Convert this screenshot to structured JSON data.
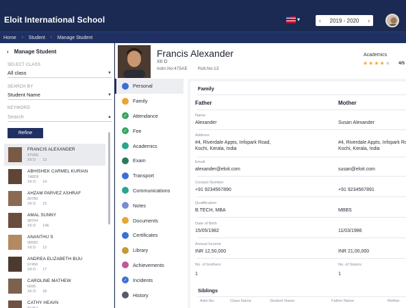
{
  "app": {
    "title": "Eloit International School",
    "year": "2019 - 2020"
  },
  "breadcrumb": [
    "Home",
    "Student",
    "Manage Student"
  ],
  "sidebar": {
    "heading": "Manage Student",
    "select_class_label": "SELECT CLASS",
    "select_class_value": "All class",
    "search_by_label": "SEARCH BY",
    "search_by_value": "Student Name",
    "keyword_label": "KEYWORD",
    "keyword_placeholder": "Search",
    "refine_label": "Refine",
    "students": [
      {
        "name": "FRANCIS ALEXANDER",
        "adm": "475AE",
        "class": "XII D",
        "roll": "13"
      },
      {
        "name": "ABHISHEK CARMEL KURIAN",
        "adm": "74BDF",
        "class": "XII D",
        "roll": "14"
      },
      {
        "name": "AHZAM PARVEZ ASHRAF",
        "adm": "89780",
        "class": "XII D",
        "roll": "15"
      },
      {
        "name": "AMAL SUNNY",
        "adm": "98764",
        "class": "XII D",
        "roll": "14E"
      },
      {
        "name": "ANANTHU S",
        "adm": "96582",
        "class": "XII D",
        "roll": "12"
      },
      {
        "name": "ANDREA ELIZABETH BIJU",
        "adm": "67456",
        "class": "XII D",
        "roll": "17"
      },
      {
        "name": "CAROLINE MATHEW",
        "adm": "6695",
        "class": "XII D",
        "roll": "18"
      },
      {
        "name": "CATHY HEAVN",
        "adm": "87454",
        "class": "XII D",
        "roll": "19"
      }
    ]
  },
  "profile": {
    "name": "Francis Alexander",
    "class": "XII D",
    "adm": "Adm.No:475AE",
    "roll": "Roll.No:13",
    "academics_label": "Academics",
    "stars_filled": 4,
    "stars_total": 5,
    "score": "4/5"
  },
  "nav": [
    {
      "label": "Personal",
      "icon": "person-icon",
      "color": "#3b6fd8",
      "active": true
    },
    {
      "label": "Family",
      "icon": "family-icon",
      "color": "#e7a534"
    },
    {
      "label": "Attendance",
      "icon": "check-circle-icon",
      "color": "#3aa55c"
    },
    {
      "label": "Fee",
      "icon": "fee-icon",
      "color": "#3aa55c"
    },
    {
      "label": "Academics",
      "icon": "academics-icon",
      "color": "#2aa58e"
    },
    {
      "label": "Exam",
      "icon": "exam-icon",
      "color": "#2b7a5a"
    },
    {
      "label": "Transport",
      "icon": "bus-icon",
      "color": "#3b6fd8"
    },
    {
      "label": "Communications",
      "icon": "chat-icon",
      "color": "#2aa58e"
    },
    {
      "label": "Notes",
      "icon": "notes-icon",
      "color": "#7b8bd0"
    },
    {
      "label": "Documents",
      "icon": "folder-icon",
      "color": "#e7a534"
    },
    {
      "label": "Certificates",
      "icon": "certificate-icon",
      "color": "#3b6fd8"
    },
    {
      "label": "Library",
      "icon": "library-icon",
      "color": "#c49a3a"
    },
    {
      "label": "Achievements",
      "icon": "achievement-icon",
      "color": "#c0589a"
    },
    {
      "label": "Incidents",
      "icon": "incident-icon",
      "color": "#3b6fd8"
    },
    {
      "label": "History",
      "icon": "history-icon",
      "color": "#555b66"
    }
  ],
  "family": {
    "section_title": "Family",
    "father_label": "Father",
    "mother_label": "Mother",
    "fields": [
      {
        "label": "Name",
        "father": "Alexander",
        "mother": "Susan Alexander"
      },
      {
        "label": "Address",
        "father": "#4, Riverdale Appts, Infopark Road, Kochi, Kerala, India",
        "mother": "#4, Riverdale Appts, Infopark Road, Kochi, Kerala, India"
      },
      {
        "label": "Email",
        "father": "alexander@eloit.com",
        "mother": "susan@eloit.com"
      },
      {
        "label": "Contact Number",
        "father": "+91 9234567890",
        "mother": "+91 9234567891"
      },
      {
        "label": "Qualification",
        "father": "B.TECH, MBA",
        "mother": "MBBS"
      },
      {
        "label": "Date of Birth",
        "father": "15/05/1982",
        "mother": "11/03/1986"
      },
      {
        "label": "Annual Income",
        "father": "INR 12,50,000",
        "mother": "INR 21,00,000"
      }
    ],
    "brothers_label": "No. of brothers",
    "brothers_value": "1",
    "sisters_label": "No. of Sisters",
    "sisters_value": "1"
  },
  "siblings": {
    "section_title": "Siblings",
    "columns": [
      "Adm.No",
      "Class Name",
      "Student Name",
      "Father Name",
      "Mother"
    ]
  }
}
